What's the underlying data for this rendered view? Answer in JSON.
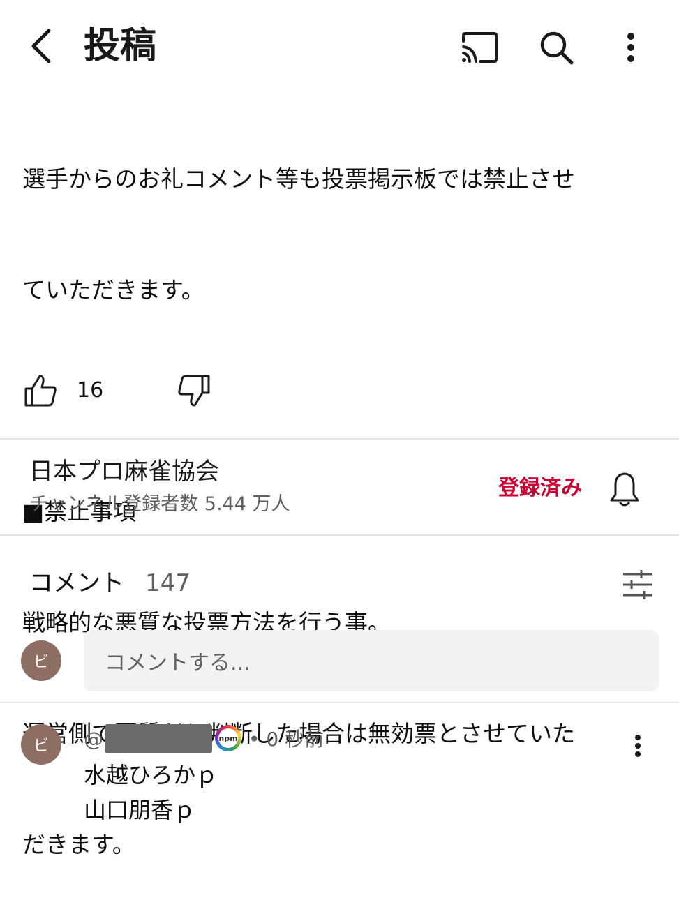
{
  "header": {
    "title": "投稿",
    "icons": [
      "back-arrow-icon",
      "cast-icon",
      "search-icon",
      "more-vert-icon"
    ]
  },
  "post": {
    "body_lines": [
      "選手からのお礼コメント等も投票掲示板では禁止させ",
      "ていただきます。",
      "",
      "■禁止事項",
      "戦略的な悪質な投票方法を行う事。",
      "運営側で悪質だと判断した場合は無効票とさせていた",
      "だきます。"
    ],
    "like_count": "16"
  },
  "channel": {
    "name": "日本プロ麻雀協会",
    "subscribers": "チャンネル登録者数 5.44 万人",
    "subscribe_label": "登録済み",
    "subscribe_color": "#cc0033"
  },
  "comments": {
    "title": "コメント",
    "count": "147",
    "input_placeholder": "コメントする...",
    "user_avatar_initial": "ビ",
    "items": [
      {
        "avatar_initial": "ビ",
        "handle_prefix": "@",
        "badge_text": "npm",
        "time": "• 0 秒前",
        "lines": [
          "水越ひろかｐ",
          "山口朋香ｐ"
        ]
      }
    ]
  }
}
